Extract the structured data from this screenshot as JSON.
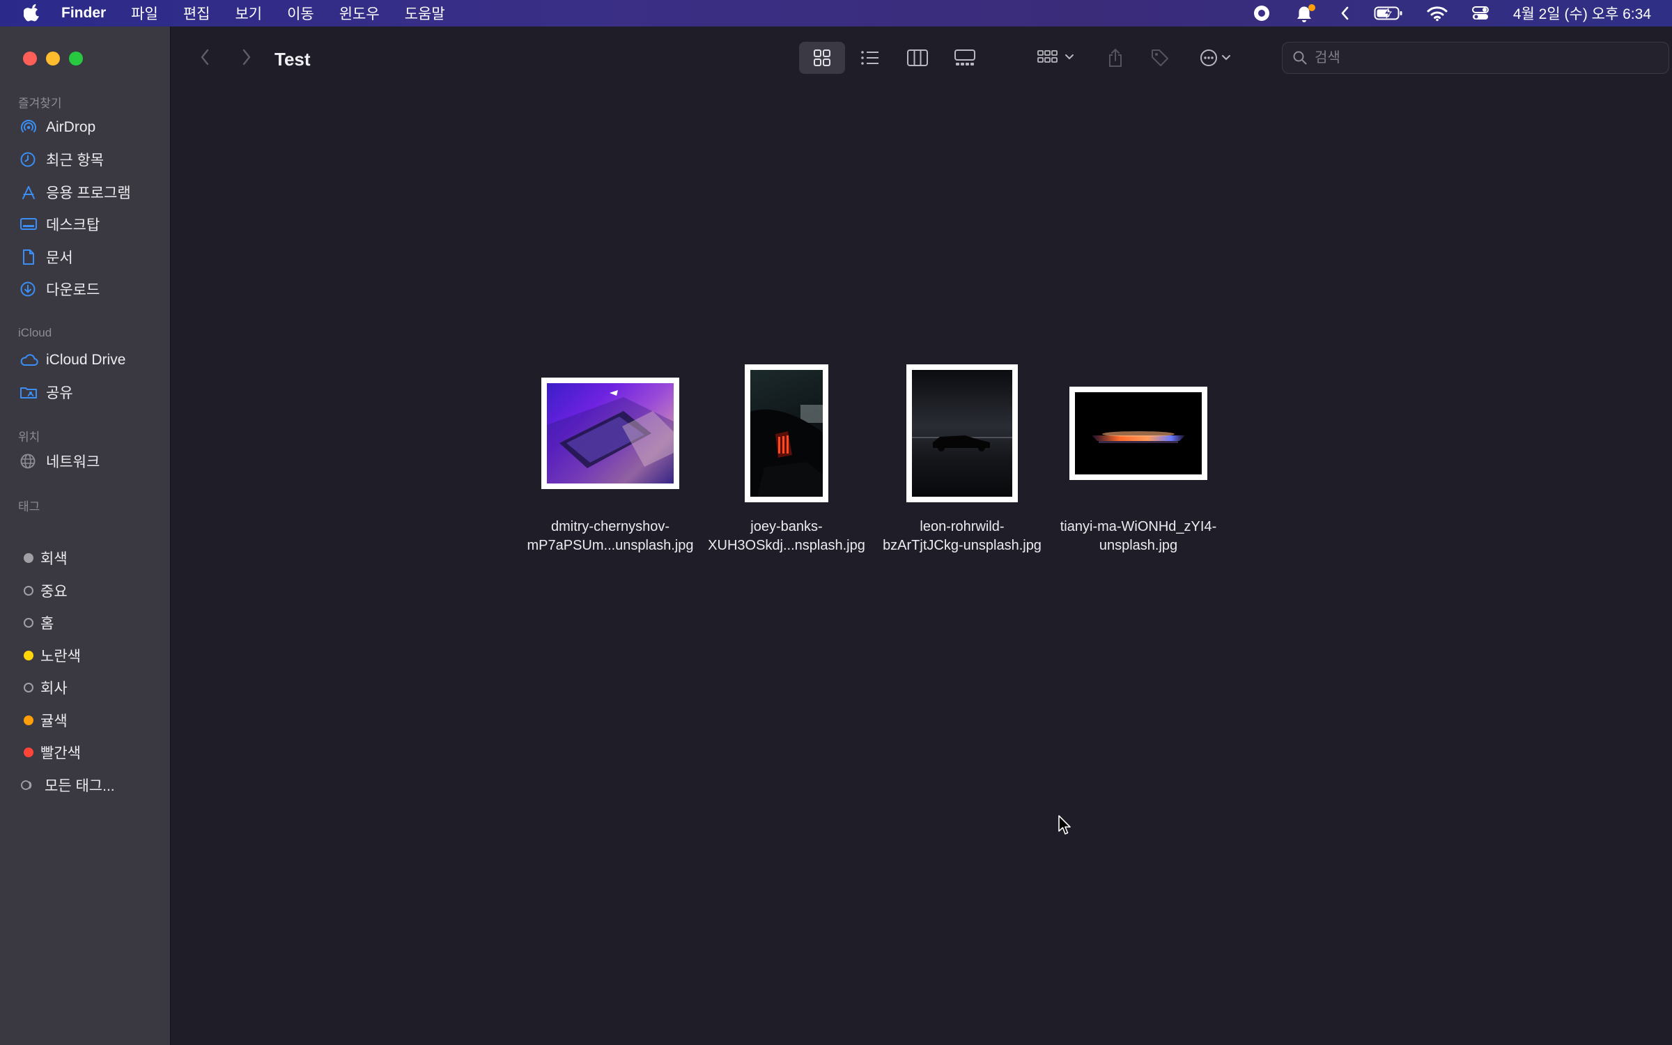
{
  "menubar": {
    "app_name": "Finder",
    "items": [
      "파일",
      "편집",
      "보기",
      "이동",
      "윈도우",
      "도움말"
    ],
    "clock": "4월 2일 (수) 오후 6:34",
    "status_icons": [
      "screen-record-icon",
      "notification-bell-icon",
      "chevron-left-icon",
      "battery-icon",
      "wifi-icon",
      "control-center-icon"
    ]
  },
  "window": {
    "title": "Test",
    "search_placeholder": "검색",
    "accent": "#3a8ef6"
  },
  "sidebar": {
    "favorites_header": "즐겨찾기",
    "favorites": [
      {
        "label": "AirDrop",
        "icon": "airdrop-icon"
      },
      {
        "label": "최근 항목",
        "icon": "clock-icon"
      },
      {
        "label": "응용 프로그램",
        "icon": "apps-icon"
      },
      {
        "label": "데스크탑",
        "icon": "desktop-icon"
      },
      {
        "label": "문서",
        "icon": "document-icon"
      },
      {
        "label": "다운로드",
        "icon": "download-icon"
      }
    ],
    "icloud_header": "iCloud",
    "icloud": [
      {
        "label": "iCloud Drive",
        "icon": "cloud-icon"
      },
      {
        "label": "공유",
        "icon": "shared-folder-icon"
      }
    ],
    "locations_header": "위치",
    "locations": [
      {
        "label": "네트워크",
        "icon": "network-icon"
      }
    ],
    "tags_header": "태그",
    "tags": [
      {
        "label": "회색",
        "color": "#a0a0a6",
        "filled": true
      },
      {
        "label": "중요",
        "color": "#a0a0a6",
        "filled": false
      },
      {
        "label": "홈",
        "color": "#a0a0a6",
        "filled": false
      },
      {
        "label": "노란색",
        "color": "#ffd60a",
        "filled": true
      },
      {
        "label": "회사",
        "color": "#a0a0a6",
        "filled": false
      },
      {
        "label": "귤색",
        "color": "#ff9f0a",
        "filled": true
      },
      {
        "label": "빨간색",
        "color": "#ff453a",
        "filled": true
      }
    ],
    "all_tags": "모든 태그..."
  },
  "files": [
    {
      "name_line1": "dmitry-chernyshov-",
      "name_line2": "mP7aPSUm...unsplash.jpg"
    },
    {
      "name_line1": "joey-banks-",
      "name_line2": "XUH3OSkdj...nsplash.jpg"
    },
    {
      "name_line1": "leon-rohrwild-",
      "name_line2": "bzArTjtJCkg-unsplash.jpg"
    },
    {
      "name_line1": "tianyi-ma-WiONHd_zYI4-",
      "name_line2": "unsplash.jpg"
    }
  ]
}
